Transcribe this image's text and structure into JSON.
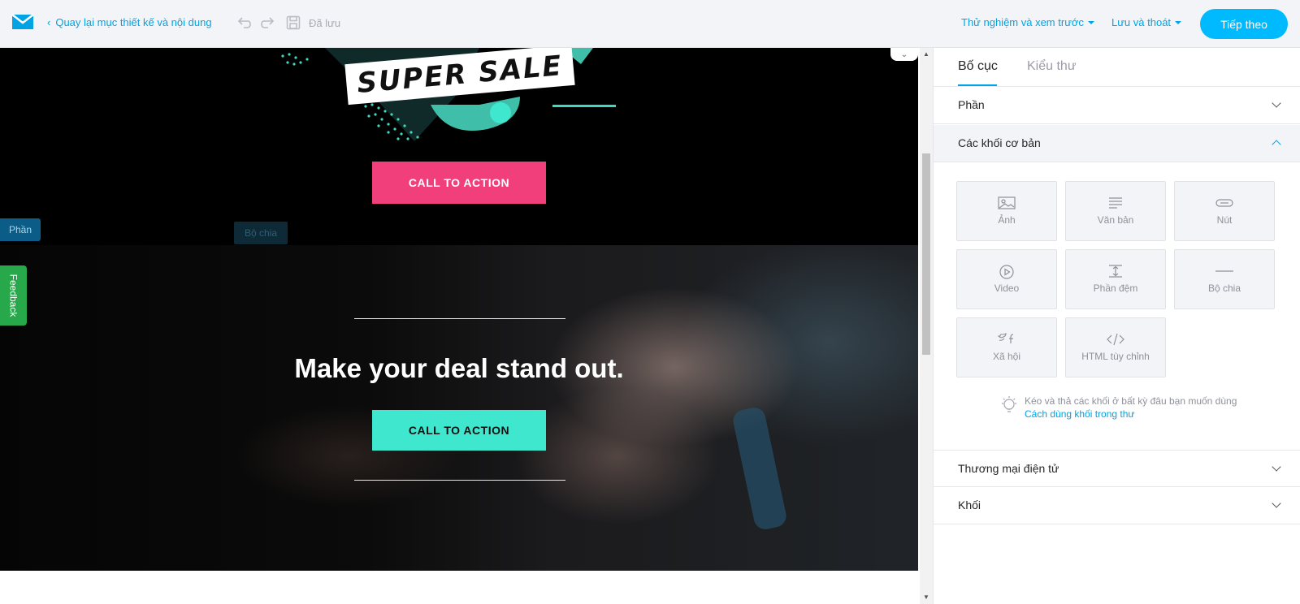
{
  "topbar": {
    "back_label": "Quay lại mục thiết kế và nội dung",
    "saved_label": "Đã lưu",
    "preview_label": "Thử nghiệm và xem trước",
    "save_exit_label": "Lưu và thoát",
    "next_label": "Tiếp theo",
    "accent_color": "#00a4e4"
  },
  "email": {
    "super_sale": "SUPER SALE",
    "cta_pink": "CALL TO ACTION",
    "cta_teal": "CALL TO ACTION",
    "headline": "Make your deal stand out.",
    "tag_section": "Phần",
    "tag_divider": "Bộ chia",
    "pink_color": "#f03f7b",
    "teal_color": "#3ee7cd"
  },
  "feedback_label": "Feedback",
  "panel": {
    "tabs": [
      {
        "label": "Bố cục"
      },
      {
        "label": "Kiểu thư"
      }
    ],
    "sections": {
      "phan": "Phần",
      "basic_blocks": "Các khối cơ bản",
      "ecommerce": "Thương mại điện tử",
      "blocks": "Khối"
    },
    "basic_blocks": [
      {
        "label": "Ảnh",
        "icon": "image-icon"
      },
      {
        "label": "Văn bản",
        "icon": "text-icon"
      },
      {
        "label": "Nút",
        "icon": "button-icon"
      },
      {
        "label": "Video",
        "icon": "play-icon"
      },
      {
        "label": "Phần đệm",
        "icon": "spacer-icon"
      },
      {
        "label": "Bộ chia",
        "icon": "divider-icon"
      },
      {
        "label": "Xã hội",
        "icon": "social-icon"
      },
      {
        "label": "HTML tùy chỉnh",
        "icon": "code-icon"
      }
    ],
    "hint_text": "Kéo và thả các khối ở bất kỳ đâu bạn muốn dùng",
    "hint_link": "Cách dùng khối trong thư"
  }
}
